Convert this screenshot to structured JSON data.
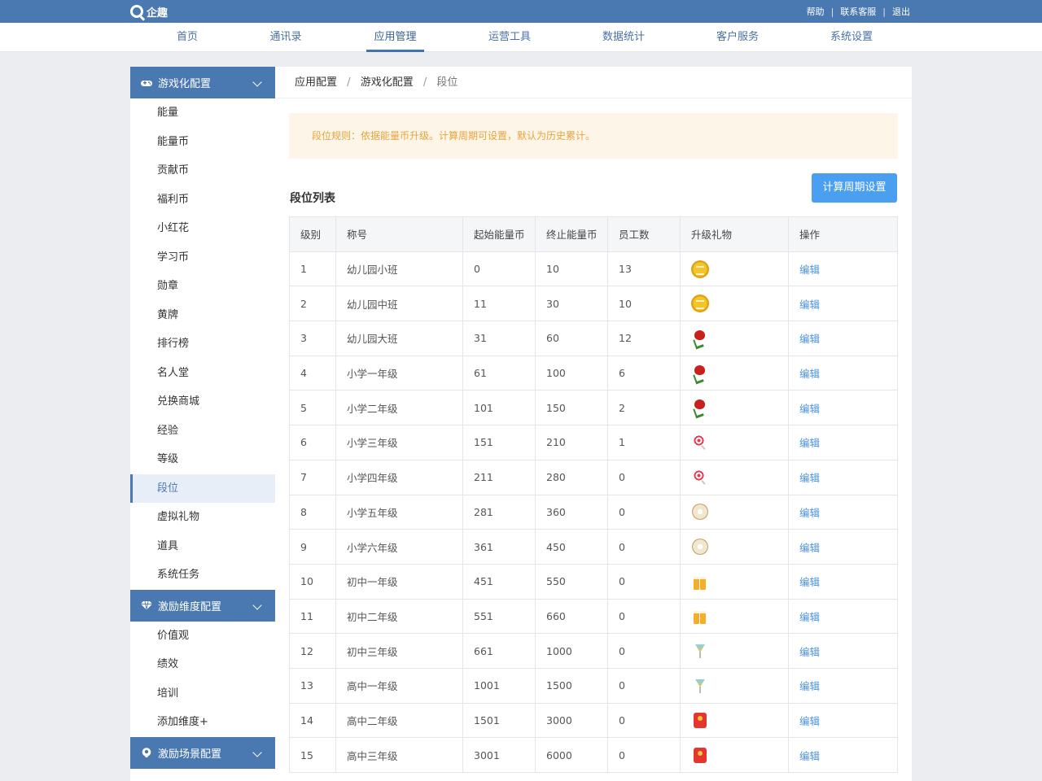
{
  "brand": {
    "name": "企趣",
    "logo_icon": "q-logo-icon"
  },
  "top_links": [
    "帮助",
    "联系客服",
    "退出"
  ],
  "top_sep": "|",
  "nav": [
    "首页",
    "通讯录",
    "应用管理",
    "运营工具",
    "数据统计",
    "客户服务",
    "系统设置"
  ],
  "nav_active": "应用管理",
  "sidebar": {
    "groups": [
      {
        "title": "游戏化配置",
        "icon": "gamepad-icon",
        "items": [
          "能量",
          "能量币",
          "贡献币",
          "福利币",
          "小红花",
          "学习币",
          "勋章",
          "黄牌",
          "排行榜",
          "名人堂",
          "兑换商城",
          "经验",
          "等级",
          "段位",
          "虚拟礼物",
          "道具",
          "系统任务"
        ]
      },
      {
        "title": "激励维度配置",
        "icon": "diamond-icon",
        "items": [
          "价值观",
          "绩效",
          "培训",
          "添加维度+"
        ]
      },
      {
        "title": "激励场景配置",
        "icon": "scene-icon",
        "items": []
      }
    ],
    "active_item": "段位"
  },
  "breadcrumb": [
    "应用配置",
    "游戏化配置",
    "段位"
  ],
  "breadcrumb_sep": "/",
  "notice": "段位规则：依据能量币升级。计算周期可设置，默认为历史累计。",
  "list_title": "段位列表",
  "period_button": "计算周期设置",
  "table": {
    "headers": [
      "级别",
      "称号",
      "起始能量币",
      "终止能量币",
      "员工数",
      "升级礼物",
      "操作"
    ],
    "rows": [
      {
        "level": "1",
        "title": "幼儿园小班",
        "start": "0",
        "end": "10",
        "count": "13",
        "gift": "coin",
        "op": "编辑"
      },
      {
        "level": "2",
        "title": "幼儿园中班",
        "start": "11",
        "end": "30",
        "count": "10",
        "gift": "coin",
        "op": "编辑"
      },
      {
        "level": "3",
        "title": "幼儿园大班",
        "start": "31",
        "end": "60",
        "count": "12",
        "gift": "rose",
        "op": "编辑"
      },
      {
        "level": "4",
        "title": "小学一年级",
        "start": "61",
        "end": "100",
        "count": "6",
        "gift": "rose",
        "op": "编辑"
      },
      {
        "level": "5",
        "title": "小学二年级",
        "start": "101",
        "end": "150",
        "count": "2",
        "gift": "rose",
        "op": "编辑"
      },
      {
        "level": "6",
        "title": "小学三年级",
        "start": "151",
        "end": "210",
        "count": "1",
        "gift": "lollipop",
        "op": "编辑"
      },
      {
        "level": "7",
        "title": "小学四年级",
        "start": "211",
        "end": "280",
        "count": "0",
        "gift": "lollipop",
        "op": "编辑"
      },
      {
        "level": "8",
        "title": "小学五年级",
        "start": "281",
        "end": "360",
        "count": "0",
        "gift": "donut",
        "op": "编辑"
      },
      {
        "level": "9",
        "title": "小学六年级",
        "start": "361",
        "end": "450",
        "count": "0",
        "gift": "donut",
        "op": "编辑"
      },
      {
        "level": "10",
        "title": "初中一年级",
        "start": "451",
        "end": "550",
        "count": "0",
        "gift": "beer",
        "op": "编辑"
      },
      {
        "level": "11",
        "title": "初中二年级",
        "start": "551",
        "end": "660",
        "count": "0",
        "gift": "beer",
        "op": "编辑"
      },
      {
        "level": "12",
        "title": "初中三年级",
        "start": "661",
        "end": "1000",
        "count": "0",
        "gift": "cocktail",
        "op": "编辑"
      },
      {
        "level": "13",
        "title": "高中一年级",
        "start": "1001",
        "end": "1500",
        "count": "0",
        "gift": "cocktail",
        "op": "编辑"
      },
      {
        "level": "14",
        "title": "高中二年级",
        "start": "1501",
        "end": "3000",
        "count": "0",
        "gift": "envelope",
        "op": "编辑"
      },
      {
        "level": "15",
        "title": "高中三年级",
        "start": "3001",
        "end": "6000",
        "count": "0",
        "gift": "envelope",
        "op": "编辑"
      }
    ]
  },
  "colors": {
    "primary": "#4a78b0",
    "button": "#4a9ff0",
    "notice_bg": "#fdf5e8",
    "notice_text": "#e8a33d",
    "link": "#4a90e2"
  }
}
